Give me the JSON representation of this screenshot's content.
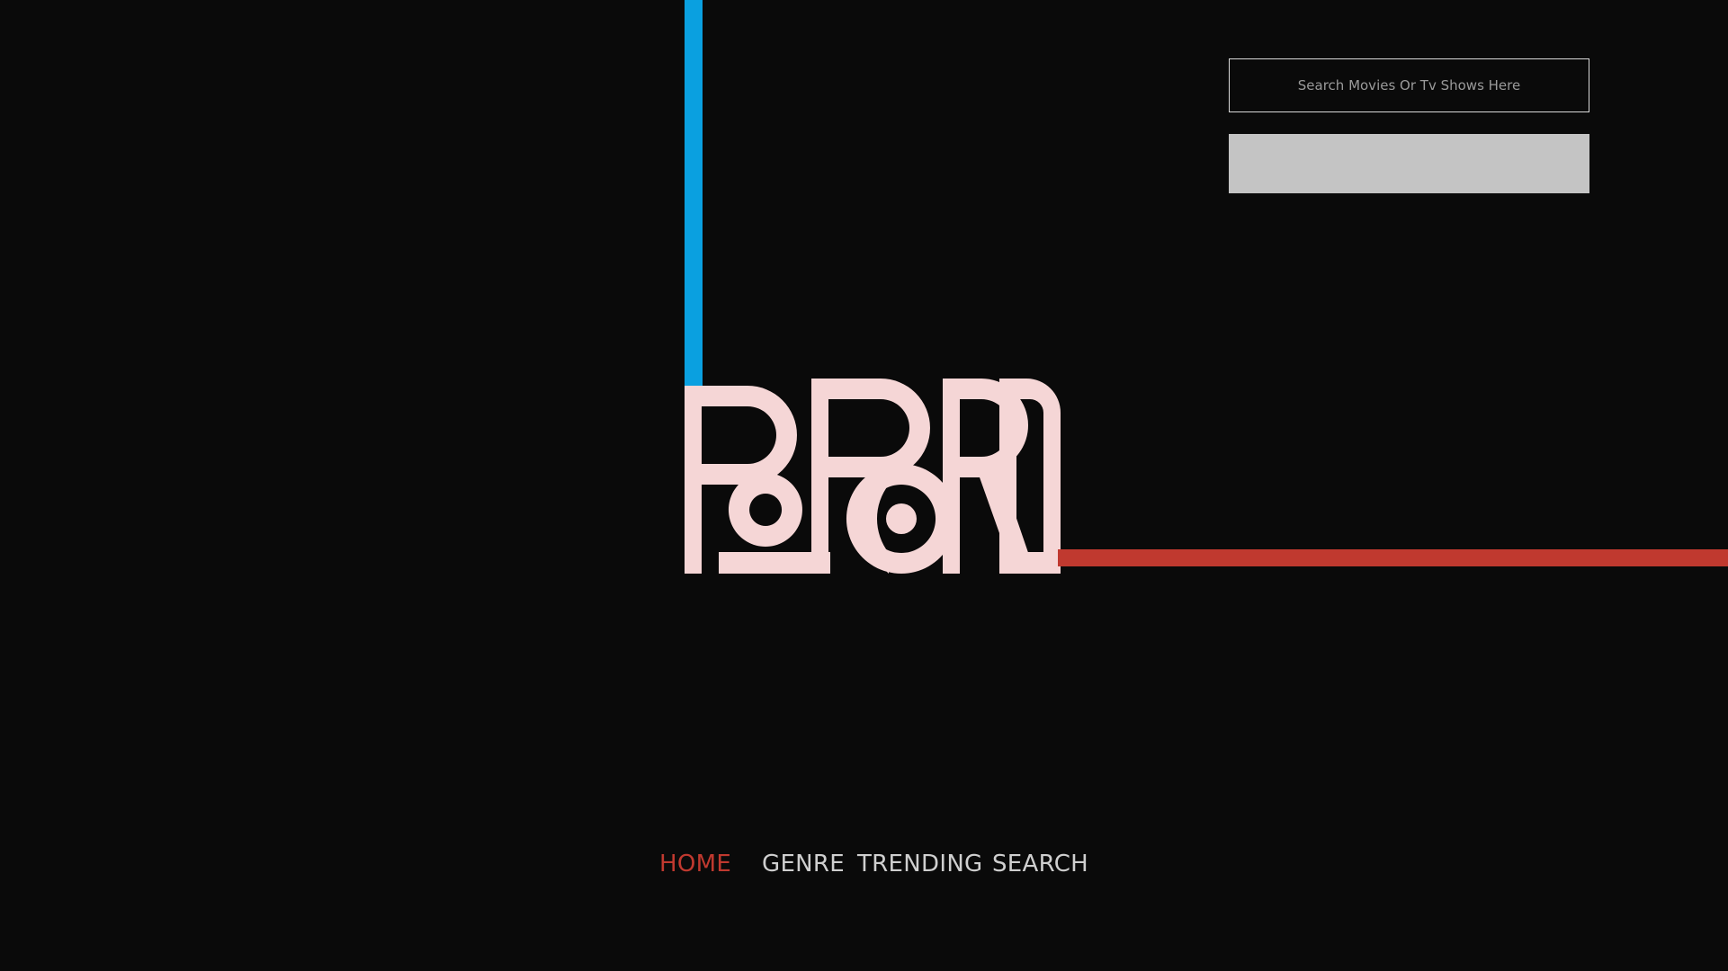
{
  "brand": {
    "logo_text": "POPCORN",
    "logo_color": "#f5d6d6",
    "accent_blue": "#0aa0e0",
    "accent_red": "#c0392f",
    "background": "#0a0a0a"
  },
  "search": {
    "placeholder": "Search Movies Or Tv Shows Here",
    "value": "",
    "button_label": ""
  },
  "nav": {
    "items": [
      {
        "label": "HOME",
        "active": true
      },
      {
        "label": "GENRE",
        "active": false
      },
      {
        "label": "TRENDING",
        "active": false
      },
      {
        "label": "SEARCH",
        "active": false
      }
    ]
  }
}
